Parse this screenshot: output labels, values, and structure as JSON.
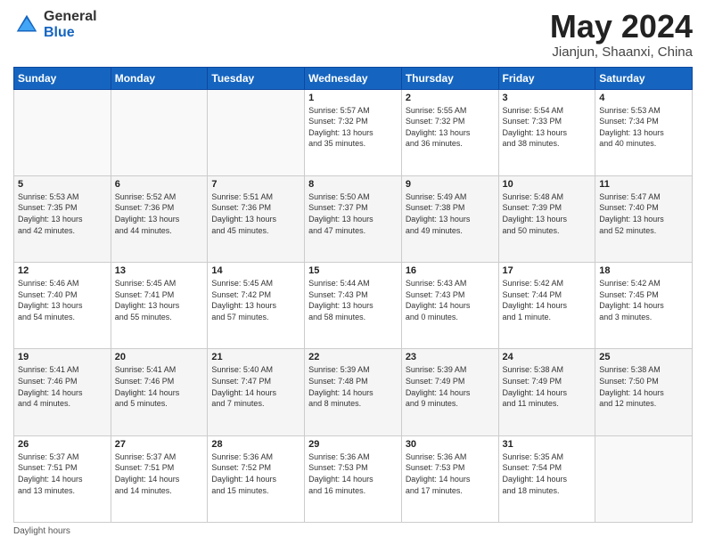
{
  "header": {
    "logo_general": "General",
    "logo_blue": "Blue",
    "title": "May 2024",
    "location": "Jianjun, Shaanxi, China"
  },
  "days_of_week": [
    "Sunday",
    "Monday",
    "Tuesday",
    "Wednesday",
    "Thursday",
    "Friday",
    "Saturday"
  ],
  "weeks": [
    [
      {
        "day": "",
        "info": ""
      },
      {
        "day": "",
        "info": ""
      },
      {
        "day": "",
        "info": ""
      },
      {
        "day": "1",
        "info": "Sunrise: 5:57 AM\nSunset: 7:32 PM\nDaylight: 13 hours\nand 35 minutes."
      },
      {
        "day": "2",
        "info": "Sunrise: 5:55 AM\nSunset: 7:32 PM\nDaylight: 13 hours\nand 36 minutes."
      },
      {
        "day": "3",
        "info": "Sunrise: 5:54 AM\nSunset: 7:33 PM\nDaylight: 13 hours\nand 38 minutes."
      },
      {
        "day": "4",
        "info": "Sunrise: 5:53 AM\nSunset: 7:34 PM\nDaylight: 13 hours\nand 40 minutes."
      }
    ],
    [
      {
        "day": "5",
        "info": "Sunrise: 5:53 AM\nSunset: 7:35 PM\nDaylight: 13 hours\nand 42 minutes."
      },
      {
        "day": "6",
        "info": "Sunrise: 5:52 AM\nSunset: 7:36 PM\nDaylight: 13 hours\nand 44 minutes."
      },
      {
        "day": "7",
        "info": "Sunrise: 5:51 AM\nSunset: 7:36 PM\nDaylight: 13 hours\nand 45 minutes."
      },
      {
        "day": "8",
        "info": "Sunrise: 5:50 AM\nSunset: 7:37 PM\nDaylight: 13 hours\nand 47 minutes."
      },
      {
        "day": "9",
        "info": "Sunrise: 5:49 AM\nSunset: 7:38 PM\nDaylight: 13 hours\nand 49 minutes."
      },
      {
        "day": "10",
        "info": "Sunrise: 5:48 AM\nSunset: 7:39 PM\nDaylight: 13 hours\nand 50 minutes."
      },
      {
        "day": "11",
        "info": "Sunrise: 5:47 AM\nSunset: 7:40 PM\nDaylight: 13 hours\nand 52 minutes."
      }
    ],
    [
      {
        "day": "12",
        "info": "Sunrise: 5:46 AM\nSunset: 7:40 PM\nDaylight: 13 hours\nand 54 minutes."
      },
      {
        "day": "13",
        "info": "Sunrise: 5:45 AM\nSunset: 7:41 PM\nDaylight: 13 hours\nand 55 minutes."
      },
      {
        "day": "14",
        "info": "Sunrise: 5:45 AM\nSunset: 7:42 PM\nDaylight: 13 hours\nand 57 minutes."
      },
      {
        "day": "15",
        "info": "Sunrise: 5:44 AM\nSunset: 7:43 PM\nDaylight: 13 hours\nand 58 minutes."
      },
      {
        "day": "16",
        "info": "Sunrise: 5:43 AM\nSunset: 7:43 PM\nDaylight: 14 hours\nand 0 minutes."
      },
      {
        "day": "17",
        "info": "Sunrise: 5:42 AM\nSunset: 7:44 PM\nDaylight: 14 hours\nand 1 minute."
      },
      {
        "day": "18",
        "info": "Sunrise: 5:42 AM\nSunset: 7:45 PM\nDaylight: 14 hours\nand 3 minutes."
      }
    ],
    [
      {
        "day": "19",
        "info": "Sunrise: 5:41 AM\nSunset: 7:46 PM\nDaylight: 14 hours\nand 4 minutes."
      },
      {
        "day": "20",
        "info": "Sunrise: 5:41 AM\nSunset: 7:46 PM\nDaylight: 14 hours\nand 5 minutes."
      },
      {
        "day": "21",
        "info": "Sunrise: 5:40 AM\nSunset: 7:47 PM\nDaylight: 14 hours\nand 7 minutes."
      },
      {
        "day": "22",
        "info": "Sunrise: 5:39 AM\nSunset: 7:48 PM\nDaylight: 14 hours\nand 8 minutes."
      },
      {
        "day": "23",
        "info": "Sunrise: 5:39 AM\nSunset: 7:49 PM\nDaylight: 14 hours\nand 9 minutes."
      },
      {
        "day": "24",
        "info": "Sunrise: 5:38 AM\nSunset: 7:49 PM\nDaylight: 14 hours\nand 11 minutes."
      },
      {
        "day": "25",
        "info": "Sunrise: 5:38 AM\nSunset: 7:50 PM\nDaylight: 14 hours\nand 12 minutes."
      }
    ],
    [
      {
        "day": "26",
        "info": "Sunrise: 5:37 AM\nSunset: 7:51 PM\nDaylight: 14 hours\nand 13 minutes."
      },
      {
        "day": "27",
        "info": "Sunrise: 5:37 AM\nSunset: 7:51 PM\nDaylight: 14 hours\nand 14 minutes."
      },
      {
        "day": "28",
        "info": "Sunrise: 5:36 AM\nSunset: 7:52 PM\nDaylight: 14 hours\nand 15 minutes."
      },
      {
        "day": "29",
        "info": "Sunrise: 5:36 AM\nSunset: 7:53 PM\nDaylight: 14 hours\nand 16 minutes."
      },
      {
        "day": "30",
        "info": "Sunrise: 5:36 AM\nSunset: 7:53 PM\nDaylight: 14 hours\nand 17 minutes."
      },
      {
        "day": "31",
        "info": "Sunrise: 5:35 AM\nSunset: 7:54 PM\nDaylight: 14 hours\nand 18 minutes."
      },
      {
        "day": "",
        "info": ""
      }
    ]
  ],
  "footer": {
    "daylight_label": "Daylight hours"
  }
}
